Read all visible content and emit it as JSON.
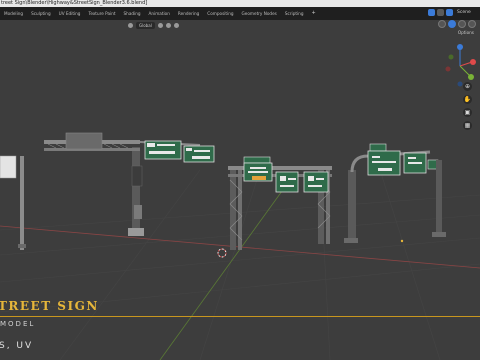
{
  "window": {
    "title": "treet Sign\\Blender\\Highway&StreetSign_Blender3.6.blend]"
  },
  "workspace_tabs": [
    {
      "label": "Modeling"
    },
    {
      "label": "Sculpting"
    },
    {
      "label": "UV Editing"
    },
    {
      "label": "Texture Paint"
    },
    {
      "label": "Shading"
    },
    {
      "label": "Animation"
    },
    {
      "label": "Rendering"
    },
    {
      "label": "Compositing"
    },
    {
      "label": "Geometry Nodes"
    },
    {
      "label": "Scripting"
    },
    {
      "label": "+"
    }
  ],
  "scene": {
    "label": "Scene"
  },
  "viewport_header": {
    "transform_orientation": "Global",
    "options_label": "Options"
  },
  "gizmo": {
    "colors": {
      "x": "#e04a4a",
      "y": "#7ab337",
      "z": "#3b7bd8"
    }
  },
  "caption": {
    "title": "TREET SIGN",
    "subtitle": "MODEL",
    "footer": "S, UV"
  },
  "colors": {
    "accent": "#e6b63a",
    "viewport_bg": "#3d3d3d",
    "sign_green": "#2f6b4a"
  }
}
